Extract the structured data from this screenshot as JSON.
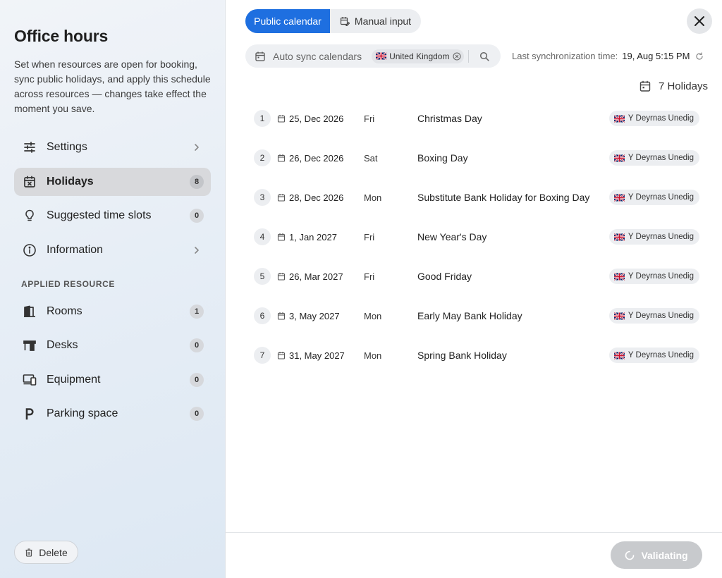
{
  "sidebar": {
    "title": "Office hours",
    "description": "Set when resources are open for booking, sync public holidays, and apply this schedule across resources — changes take effect the moment you save.",
    "nav": [
      {
        "label": "Settings",
        "icon": "sliders-icon",
        "right": "chevron"
      },
      {
        "label": "Holidays",
        "icon": "calendar-x-icon",
        "badge": "8",
        "active": true
      },
      {
        "label": "Suggested time slots",
        "icon": "lightbulb-icon",
        "badge": "0"
      },
      {
        "label": "Information",
        "icon": "info-icon",
        "right": "chevron"
      }
    ],
    "section_label": "APPLIED RESOURCE",
    "resources": [
      {
        "label": "Rooms",
        "icon": "door-icon",
        "badge": "1"
      },
      {
        "label": "Desks",
        "icon": "desk-icon",
        "badge": "0"
      },
      {
        "label": "Equipment",
        "icon": "devices-icon",
        "badge": "0"
      },
      {
        "label": "Parking space",
        "icon": "parking-icon",
        "badge": "0"
      }
    ],
    "delete_label": "Delete"
  },
  "tabs": {
    "public": "Public calendar",
    "manual": "Manual input"
  },
  "sync": {
    "label": "Auto sync calendars",
    "chip": "United Kingdom",
    "last_label": "Last synchronization time:",
    "last_value": "19, Aug 5:15 PM"
  },
  "holidays_count": "7 Holidays",
  "holidays": [
    {
      "num": "1",
      "date": "25, Dec 2026",
      "day": "Fri",
      "name": "Christmas Day",
      "tag": "Y Deyrnas Unedig"
    },
    {
      "num": "2",
      "date": "26, Dec 2026",
      "day": "Sat",
      "name": "Boxing Day",
      "tag": "Y Deyrnas Unedig"
    },
    {
      "num": "3",
      "date": "28, Dec 2026",
      "day": "Mon",
      "name": "Substitute Bank Holiday for Boxing Day",
      "tag": "Y Deyrnas Unedig"
    },
    {
      "num": "4",
      "date": "1, Jan 2027",
      "day": "Fri",
      "name": "New Year's Day",
      "tag": "Y Deyrnas Unedig"
    },
    {
      "num": "5",
      "date": "26, Mar 2027",
      "day": "Fri",
      "name": "Good Friday",
      "tag": "Y Deyrnas Unedig"
    },
    {
      "num": "6",
      "date": "3, May 2027",
      "day": "Mon",
      "name": "Early May Bank Holiday",
      "tag": "Y Deyrnas Unedig"
    },
    {
      "num": "7",
      "date": "31, May 2027",
      "day": "Mon",
      "name": "Spring Bank Holiday",
      "tag": "Y Deyrnas Unedig"
    }
  ],
  "validate_label": "Validating",
  "colors": {
    "accent": "#1e6fe0",
    "active_nav": "#d8d9dc",
    "disabled_button": "#c8cacd"
  }
}
